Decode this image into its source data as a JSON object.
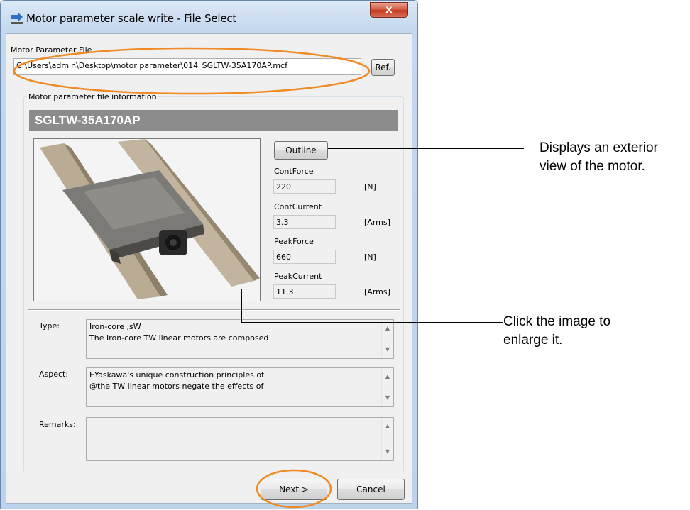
{
  "window": {
    "title": "Motor parameter scale write - File Select",
    "close_symbol": "x"
  },
  "file_section": {
    "label": "Motor Parameter File",
    "path_value": "C:\\Users\\admin\\Desktop\\motor parameter\\014_SGLTW-35A170AP.mcf",
    "ref_button": "Ref."
  },
  "info_group": {
    "title": "Motor parameter file information",
    "model_name": "SGLTW-35A170AP",
    "outline_button": "Outline",
    "specs": [
      {
        "label": "ContForce",
        "value": "220",
        "unit": "[N]"
      },
      {
        "label": "ContCurrent",
        "value": "3.3",
        "unit": "[Arms]"
      },
      {
        "label": "PeakForce",
        "value": "660",
        "unit": "[N]"
      },
      {
        "label": "PeakCurrent",
        "value": "11.3",
        "unit": "[Arms]"
      }
    ],
    "type_label": "Type:",
    "type_lines": [
      "Iron-core ,sW",
      "The Iron-core TW linear motors are composed"
    ],
    "aspect_label": "Aspect:",
    "aspect_lines": [
      "EYaskawa's unique construction principles of",
      "@the TW linear motors negate the effects of"
    ],
    "remarks_label": "Remarks:",
    "remarks_lines": [
      "",
      ""
    ]
  },
  "footer": {
    "next_button": "Next >",
    "cancel_button": "Cancel"
  },
  "callouts": {
    "outline_note_line1": "Displays an exterior",
    "outline_note_line2": "view of the motor.",
    "image_note_line1": "Click the image to",
    "image_note_line2": "enlarge it."
  },
  "colors": {
    "highlight_orange": "#f08a24",
    "header_bar": "#8c8c8c",
    "close_red": "#c43b20"
  },
  "icons": [
    "app-icon",
    "close-icon",
    "scroll-up-icon",
    "scroll-down-icon",
    "motor-photo"
  ]
}
